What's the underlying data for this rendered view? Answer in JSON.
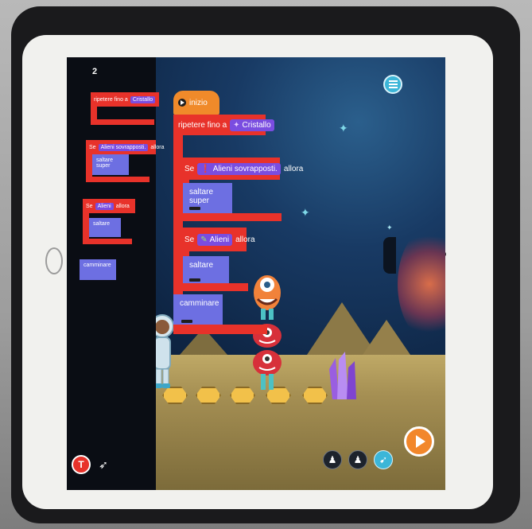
{
  "level": "2",
  "palette": {
    "repeat_label": "ripetere fino a",
    "repeat_target": "Cristallo",
    "if_label": "Se",
    "if_condition_1": "Alieni sovrapposti.",
    "then_label": "allora",
    "jump_label": "saltare super",
    "if_condition_2": "Alieni",
    "jump2_label": "saltare",
    "walk_label": "camminare"
  },
  "script": {
    "start_label": "inizio",
    "repeat_label": "ripetere fino a",
    "repeat_target": "Cristallo",
    "if1_label": "Se",
    "if1_condition": "Alieni sovrapposti.",
    "if1_then": "allora",
    "if1_action": "saltare super",
    "if2_label": "Se",
    "if2_condition": "Alieni",
    "if2_then": "allora",
    "if2_action": "saltare",
    "walk_label": "camminare"
  },
  "colors": {
    "control_block": "#e8322a",
    "action_block": "#6d6fe2",
    "tag": "#7a4de0",
    "start_block": "#f08a2a",
    "menu_button": "#3cb6d8",
    "run_button": "#f2872b"
  },
  "icons": {
    "menu": "hamburger-menu-icon",
    "run": "play-icon",
    "hint": "t-icon",
    "speed": "bird-icon",
    "zoom_out": "character-zoom-out-icon",
    "zoom_in": "character-zoom-in-icon",
    "rocket": "rocket-icon"
  }
}
